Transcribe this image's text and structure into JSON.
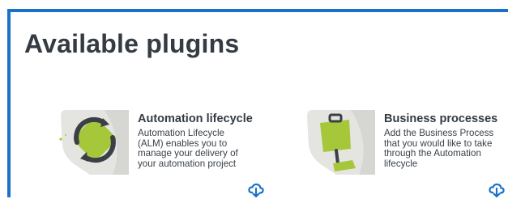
{
  "page": {
    "title": "Available plugins"
  },
  "plugins": [
    {
      "title": "Automation lifecycle",
      "description": "Automation Lifecycle\n(ALM) enables you to\nmanage your delivery of\nyour automation project",
      "icon": "automation-lifecycle-icon",
      "action_icon": "cloud-download-icon"
    },
    {
      "title": "Business processes",
      "description": "Add the Business Process\nthat you would like to take\nthrough the Automation\nlifecycle",
      "icon": "business-processes-icon",
      "action_icon": "cloud-download-icon"
    }
  ],
  "colors": {
    "frame_border": "#1a71c9",
    "title_text": "#343b43",
    "accent_green": "#a6c73a",
    "icon_bg": "#e4e4e1",
    "icon_dark": "#3b4046",
    "download_icon": "#1a71c9"
  }
}
